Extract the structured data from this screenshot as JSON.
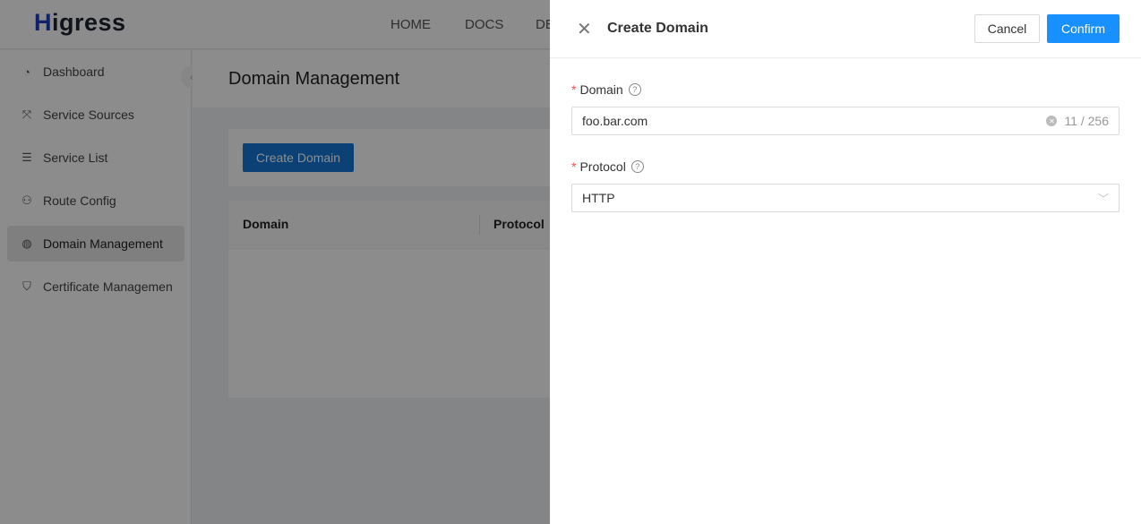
{
  "header": {
    "logo": "Higress",
    "nav": [
      "HOME",
      "DOCS",
      "DE"
    ]
  },
  "sidebar": {
    "items": [
      {
        "label": "Dashboard",
        "icon": "dashboard-icon",
        "glyph": "◔"
      },
      {
        "label": "Service Sources",
        "icon": "service-sources-icon",
        "glyph": "⤧"
      },
      {
        "label": "Service List",
        "icon": "list-icon",
        "glyph": "☰"
      },
      {
        "label": "Route Config",
        "icon": "route-icon",
        "glyph": "⚇"
      },
      {
        "label": "Domain Management",
        "icon": "globe-icon",
        "glyph": "◍"
      },
      {
        "label": "Certificate Managemen",
        "icon": "shield-icon",
        "glyph": "⛉"
      }
    ],
    "active": 4
  },
  "page": {
    "title": "Domain Management",
    "create_button": "Create Domain",
    "table": {
      "columns": [
        "Domain",
        "Protocol"
      ]
    }
  },
  "drawer": {
    "title": "Create Domain",
    "cancel": "Cancel",
    "confirm": "Confirm",
    "domain": {
      "label": "Domain",
      "value": "foo.bar.com",
      "count": "11 / 256"
    },
    "protocol": {
      "label": "Protocol",
      "value": "HTTP"
    }
  }
}
